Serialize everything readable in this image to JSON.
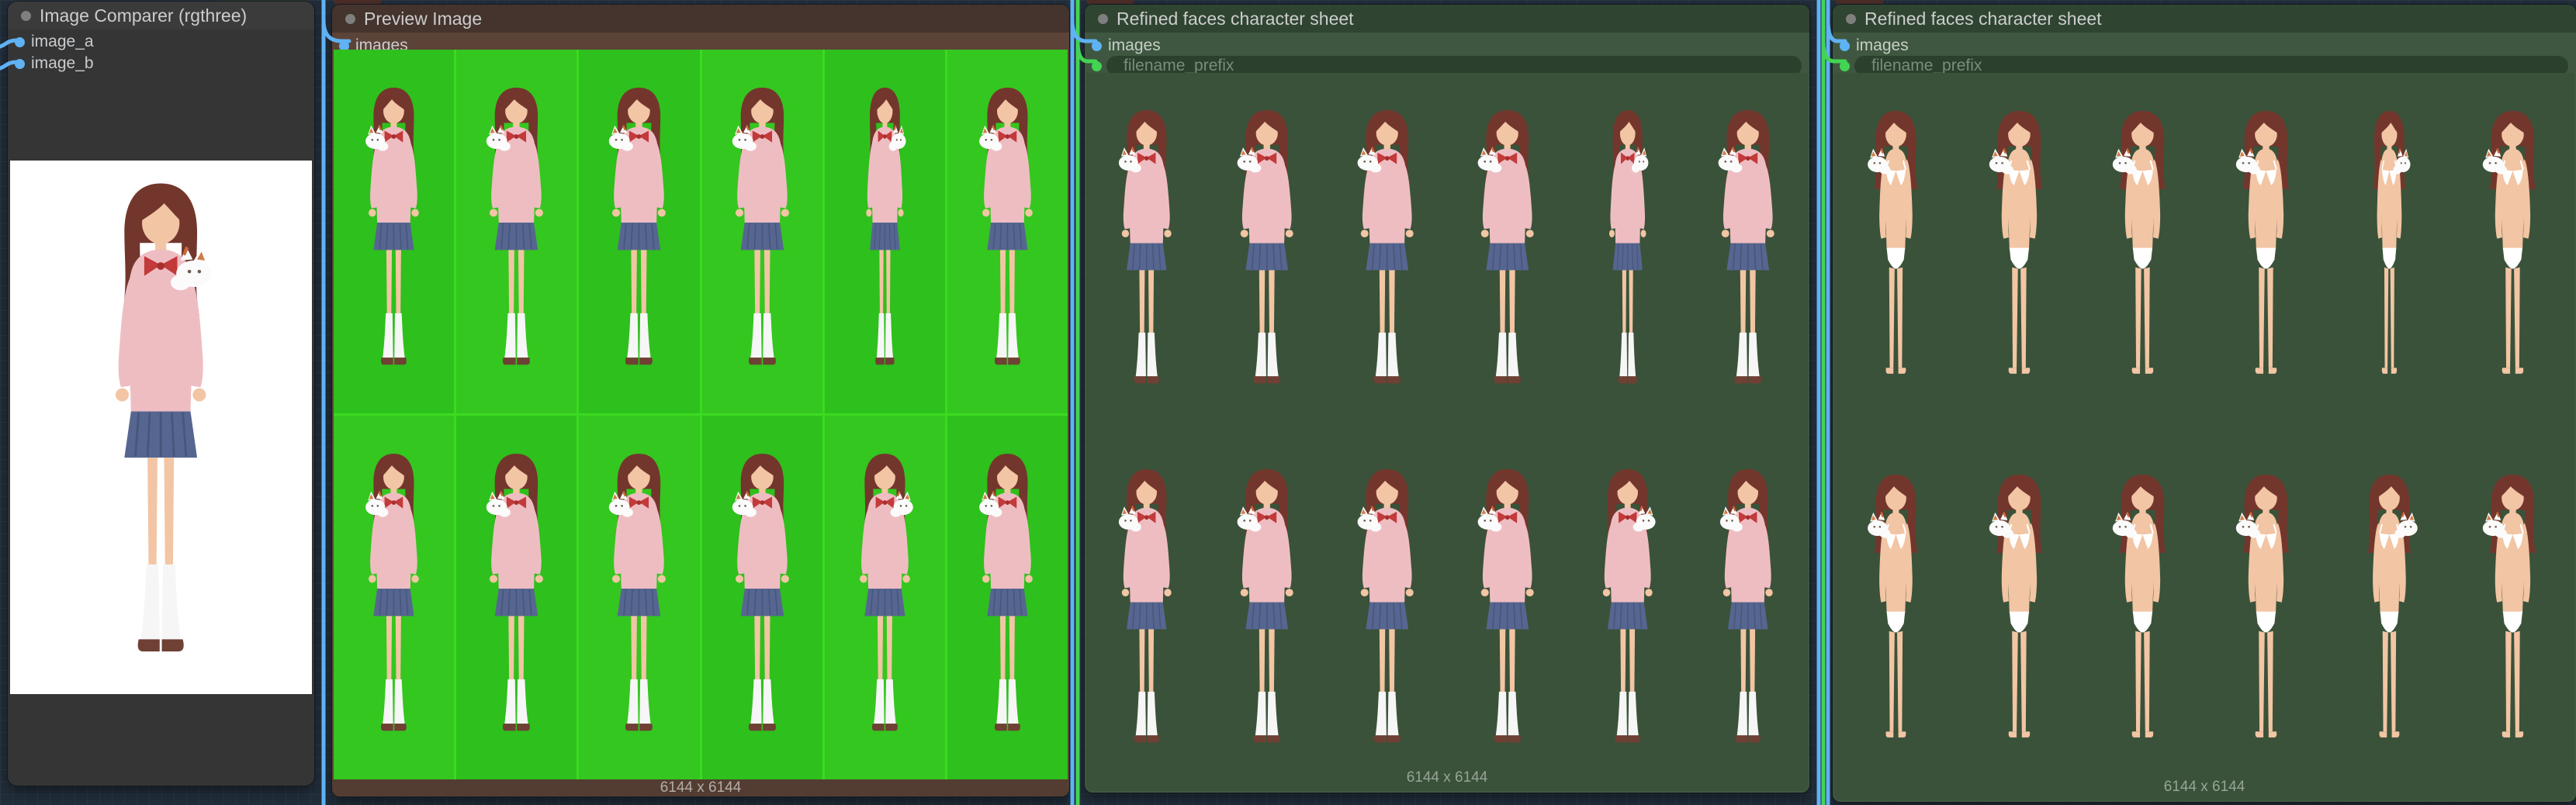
{
  "canvas": {
    "bg": "#212d3a",
    "grid_line": "#2a3643"
  },
  "links": {
    "image_link_color": "#5fb2f3",
    "string_link_color": "#43d453"
  },
  "figure": {
    "subject": "anime girl with brown hair, white cat on shoulder"
  },
  "nodes": [
    {
      "title": "Image Comparer (rgthree)",
      "inputs": [
        {
          "label": "image_a"
        },
        {
          "label": "image_b"
        }
      ],
      "preview": {
        "kind": "single",
        "outfit": "school",
        "bg": "#ffffff"
      }
    },
    {
      "title": "Preview Image",
      "inputs": [
        {
          "label": "images"
        }
      ],
      "footer": "6144 x 6144",
      "grid": {
        "cols": 6,
        "rows": 2,
        "outfit": "school",
        "bg": "#2ec01c",
        "bg_alt": "#34c71f",
        "divider": "#3bda20",
        "poses": [
          "three-quarter",
          "front",
          "front",
          "front",
          "profile-flip",
          "three-quarter",
          "three-quarter",
          "front",
          "front",
          "front",
          "three-quarter-flip",
          "three-quarter"
        ]
      }
    },
    {
      "title": "Refined faces character sheet",
      "inputs": [
        {
          "label": "images"
        }
      ],
      "widgets": [
        {
          "placeholder": "filename_prefix"
        }
      ],
      "footer": "6144 x 6144",
      "grid": {
        "cols": 6,
        "rows": 2,
        "outfit": "school",
        "bg": "#3a5239",
        "bg_alt": "#3a5239",
        "divider": "#3a5239",
        "poses": [
          "three-quarter",
          "front",
          "front",
          "front",
          "profile-flip",
          "front",
          "three-quarter",
          "front",
          "front",
          "front",
          "three-quarter-flip",
          "three-quarter"
        ]
      }
    },
    {
      "title": "Refined faces character sheet",
      "inputs": [
        {
          "label": "images"
        }
      ],
      "widgets": [
        {
          "placeholder": "filename_prefix"
        }
      ],
      "footer": "6144 x 6144",
      "grid": {
        "cols": 6,
        "rows": 2,
        "outfit": "underwear",
        "bg": "#3a5239",
        "bg_alt": "#3a5239",
        "divider": "#3a5239",
        "poses": [
          "three-quarter",
          "front",
          "front",
          "front",
          "profile-flip",
          "front",
          "three-quarter",
          "front",
          "front",
          "front",
          "three-quarter-flip",
          "front"
        ]
      }
    }
  ]
}
